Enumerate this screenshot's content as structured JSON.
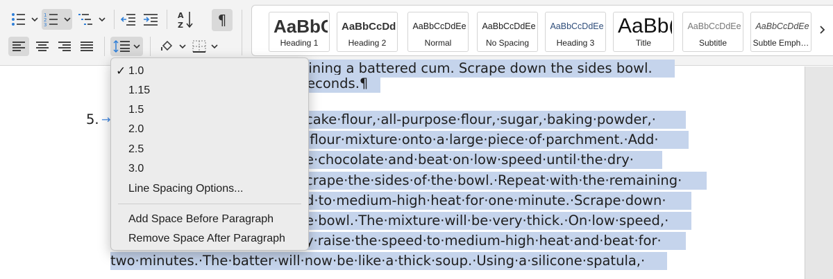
{
  "toolbar": {
    "icons": [
      "bullets-icon",
      "numbering-icon",
      "multilevel-list-icon",
      "decrease-indent-icon",
      "increase-indent-icon",
      "sort-icon",
      "show-formatting-marks-icon",
      "align-left-icon",
      "align-center-icon",
      "align-right-icon",
      "justify-icon",
      "line-spacing-icon",
      "shading-icon",
      "borders-icon"
    ],
    "colors": {
      "ribbon_bg": "#f3f3f3",
      "active_button_bg": "#d9d9d9",
      "selection": "#c5d4ec",
      "accent_blue": "#2f7fd8"
    }
  },
  "styles_gallery": {
    "items": [
      {
        "preview": "AaBbC",
        "name": "Heading 1"
      },
      {
        "preview": "AaBbCcDd",
        "name": "Heading 2"
      },
      {
        "preview": "AaBbCcDdEe",
        "name": "Normal"
      },
      {
        "preview": "AaBbCcDdEe",
        "name": "No Spacing"
      },
      {
        "preview": "AaBbCcDdEe",
        "name": "Heading 3"
      },
      {
        "preview": "AaBb(",
        "name": "Title"
      },
      {
        "preview": "AaBbCcDdEe",
        "name": "Subtitle"
      },
      {
        "preview": "AaBbCcDdEe",
        "name": "Subtle Emph…"
      }
    ]
  },
  "line_spacing_menu": {
    "selected": "1.0",
    "check_mark": "✓",
    "options": [
      "1.0",
      "1.15",
      "1.5",
      "2.0",
      "2.5",
      "3.0"
    ],
    "more_options": "Line Spacing Options...",
    "add_space_before": "Add Space Before Paragraph",
    "remove_space_after": "Remove Space After Paragraph"
  },
  "document": {
    "list_number": "5.",
    "tab_arrow": "→",
    "lines": [
      "bining a battered cum. Scrape down the sides bowl.",
      "seconds.¶",
      "cake·flour,·all-purpose·flour,·sugar,·baking·powder,·",
      "·flour·mixture·onto·a·large·piece·of·parchment.·Add·",
      "e·chocolate·and·beat·on·low·speed·until·the·dry·",
      "crape·the·sides·of·the·bowl.·Repeat·with·the·remaining·",
      "d·to·medium-high·heat·for·one·minute.·Scrape·down·",
      "e·bowl.·The·mixture·will·be·very·thick.·On·low·speed,·",
      "y·raise·the·speed·to·medium-high·heat·and·beat·for·",
      "two·minutes.·The·batter·will·now·be·like·a·thick·soup.·Using·a·silicone·spatula,·"
    ]
  }
}
